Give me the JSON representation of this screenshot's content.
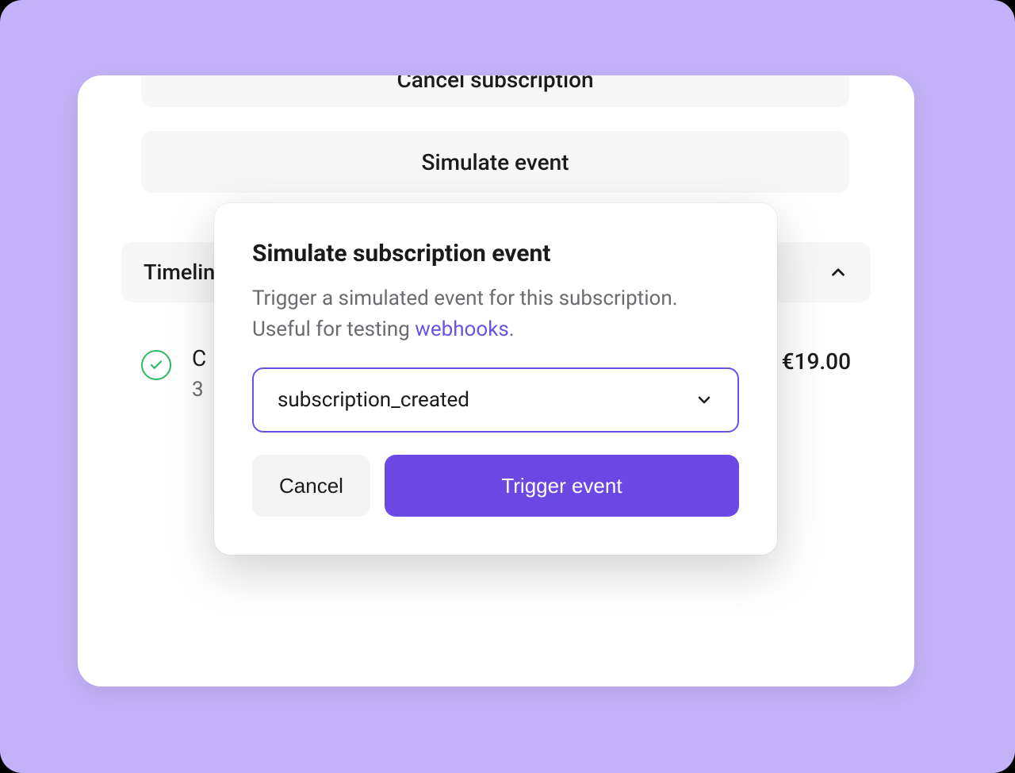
{
  "background": {
    "cancel_subscription_label": "Cancel subscription",
    "simulate_event_label": "Simulate event",
    "timeline_label": "Timeline",
    "timeline_item": {
      "title_partial": "C",
      "sub_partial": "3",
      "price": "€19.00"
    }
  },
  "modal": {
    "title": "Simulate subscription event",
    "description_prefix": "Trigger a simulated event for this subscription. Useful for testing ",
    "description_link": "webhooks",
    "description_suffix": ".",
    "select_value": "subscription_created",
    "cancel_label": "Cancel",
    "trigger_label": "Trigger event"
  }
}
